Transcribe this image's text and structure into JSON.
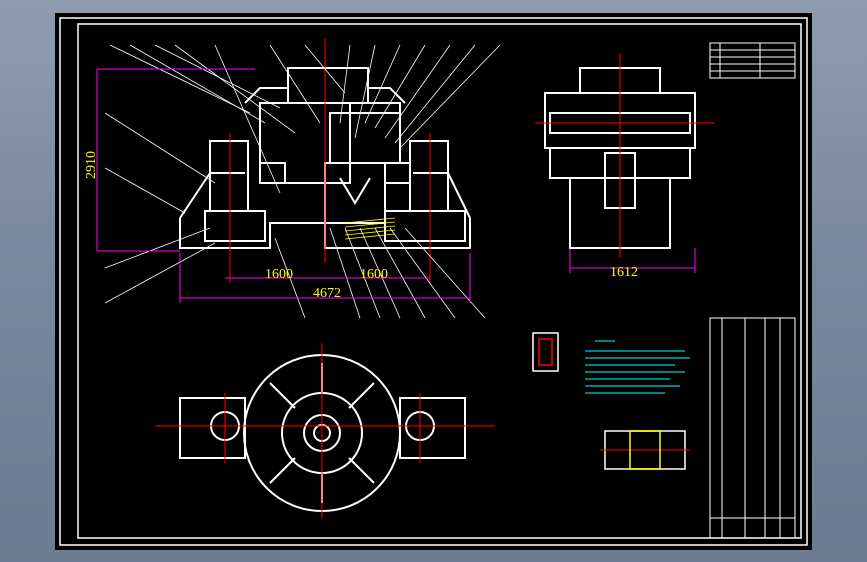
{
  "dimensions": {
    "height_left": "2910",
    "width_1600_a": "1600",
    "width_1600_b": "1600",
    "width_4672": "4672",
    "width_1612": "1612"
  },
  "colors": {
    "background": "#000000",
    "frame": "#ffffff",
    "geometry": "#ffffff",
    "dimension": "#ff00ff",
    "dimension_text": "#ffff00",
    "centerline": "#ff0000",
    "notes": "#00ffff",
    "section": "#ffff00"
  }
}
